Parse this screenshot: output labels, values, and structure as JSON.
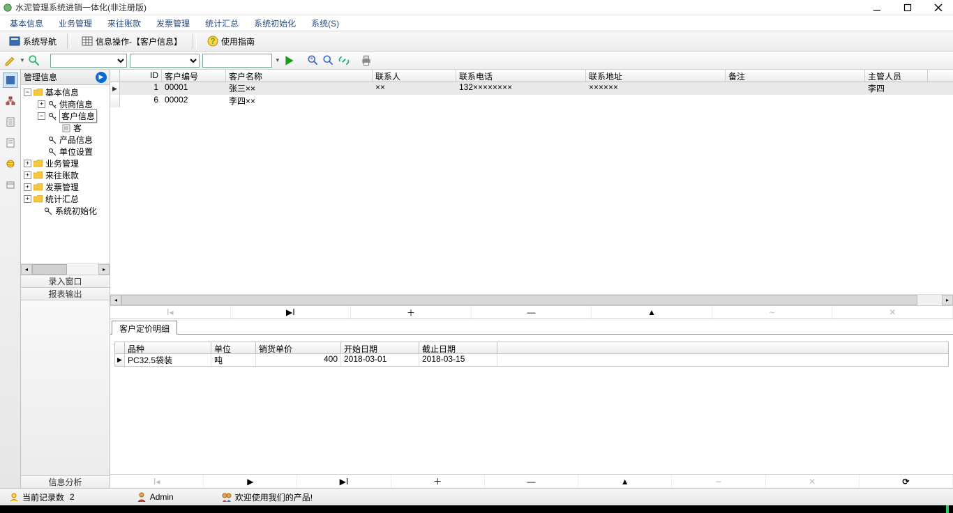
{
  "window": {
    "title": "水泥管理系统进销一体化(非注册版)"
  },
  "menubar": [
    "基本信息",
    "业务管理",
    "来往账款",
    "发票管理",
    "统计汇总",
    "系统初始化",
    "系统(S)"
  ],
  "toolbar1": {
    "nav": "系统导航",
    "info_op": "信息操作-【客户信息】",
    "guide": "使用指南"
  },
  "sidebar": {
    "header": "管理信息",
    "tree": {
      "basic": "基本信息",
      "supplier": "供商信息",
      "customer": "客户信息",
      "customer_child": "客",
      "product": "产品信息",
      "unit": "单位设置",
      "business": "业务管理",
      "accounts": "来往账款",
      "invoice": "发票管理",
      "stats": "统计汇总",
      "sysinit": "系统初始化"
    },
    "sections": {
      "entry": "录入窗口",
      "report": "报表输出",
      "analysis": "信息分析"
    }
  },
  "grid": {
    "columns": {
      "id": "ID",
      "code": "客户编号",
      "name": "客户名称",
      "contact": "联系人",
      "phone": "联系电话",
      "addr": "联系地址",
      "note": "备注",
      "mgr": "主管人员"
    },
    "rows": [
      {
        "id": "1",
        "code": "00001",
        "name": "张三××",
        "contact": "××",
        "phone": "132××××××××",
        "addr": "××××××",
        "note": "",
        "mgr": "李四"
      },
      {
        "id": "6",
        "code": "00002",
        "name": "李四××",
        "contact": "",
        "phone": "",
        "addr": "",
        "note": "",
        "mgr": ""
      }
    ]
  },
  "nav_symbols": {
    "first": "ꓲ◂",
    "prev": "◀",
    "add": "＋",
    "del": "—",
    "up": "▲",
    "muted1": "∼",
    "muted2": "✕",
    "refresh": "⟳",
    "play": "▶",
    "last": "▶ꓲ"
  },
  "detail": {
    "tab": "客户定价明细",
    "columns": {
      "variety": "品种",
      "unit": "单位",
      "price": "销货单价",
      "start": "开始日期",
      "end": "截止日期"
    },
    "rows": [
      {
        "variety": "PC32.5袋装",
        "unit": "吨",
        "price": "400",
        "start": "2018-03-01",
        "end": "2018-03-15"
      }
    ]
  },
  "statusbar": {
    "records_label": "当前记录数",
    "records_count": "2",
    "user": "Admin",
    "welcome": "欢迎使用我们的产品!"
  }
}
